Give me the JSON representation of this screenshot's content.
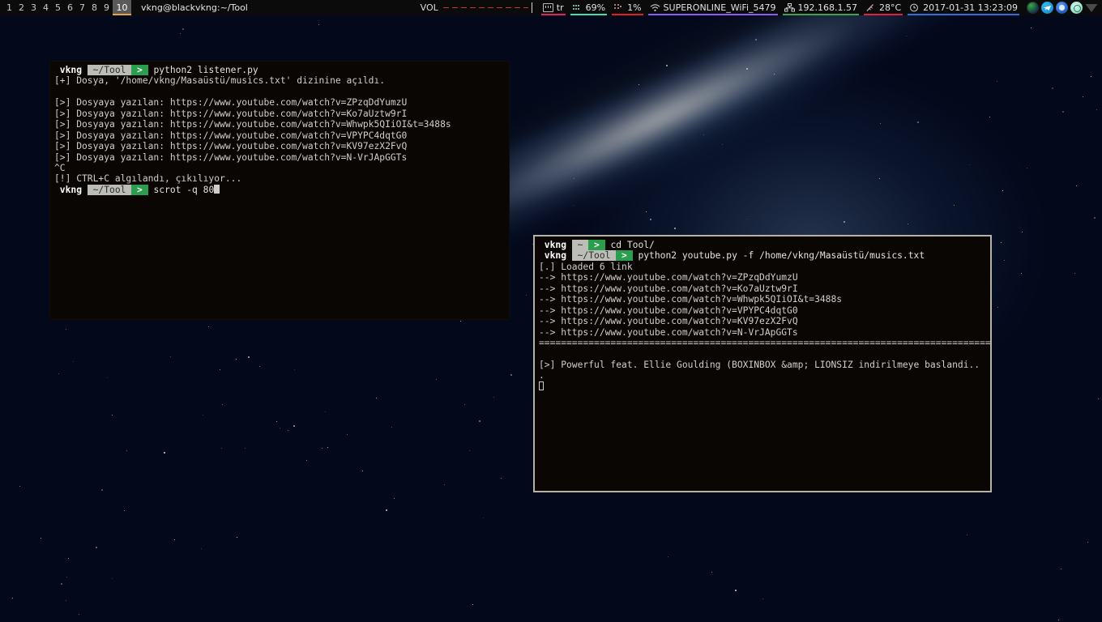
{
  "taskbar": {
    "workspaces": [
      "1",
      "2",
      "3",
      "4",
      "5",
      "6",
      "7",
      "8",
      "9",
      "10"
    ],
    "active_workspace": "10",
    "window_title": "vkng@blackvkng:~/Tool",
    "volume": {
      "label": "VOL"
    },
    "indicators": [
      {
        "name": "keyboard-layout",
        "icon": "keyboard-icon",
        "value": "tr",
        "color": "#e0245e"
      },
      {
        "name": "memory-usage",
        "icon": "memory-icon",
        "value": "69%",
        "color": "#3fe0b0"
      },
      {
        "name": "cpu-usage",
        "icon": "cpu-icon",
        "value": "1%",
        "color": "#e02020"
      },
      {
        "name": "wifi-network",
        "icon": "wifi-icon",
        "value": "SUPERONLINE_WiFi_5479",
        "color": "#8b5cf6"
      },
      {
        "name": "ip-address",
        "icon": "network-icon",
        "value": "192.168.1.57",
        "color": "#3fa34d"
      },
      {
        "name": "temperature",
        "icon": "thermometer-icon",
        "value": "28°C",
        "color": "#e02040"
      },
      {
        "name": "clock",
        "icon": "clock-icon",
        "value": "2017-01-31 13:23:09",
        "color": "#2f6fe0"
      }
    ],
    "tray": [
      "earth-icon",
      "telegram-icon",
      "browser-icon",
      "settings-icon",
      "wifi-fan-icon"
    ]
  },
  "terminal1": {
    "title": "vkng@blackvkng:~/Tool",
    "prompt": {
      "user": "vkng",
      "path": "~/Tool",
      "arrow": ">"
    },
    "lines": [
      {
        "type": "prompt",
        "command": "python2 listener.py"
      },
      {
        "type": "out",
        "text": "[+] Dosya, '/home/vkng/Masaüstü/musics.txt' dizinine açıldı."
      },
      {
        "type": "out",
        "text": ""
      },
      {
        "type": "out",
        "text": "[>] Dosyaya yazılan: https://www.youtube.com/watch?v=ZPzqDdYumzU"
      },
      {
        "type": "out",
        "text": "[>] Dosyaya yazılan: https://www.youtube.com/watch?v=Ko7aUztw9rI"
      },
      {
        "type": "out",
        "text": "[>] Dosyaya yazılan: https://www.youtube.com/watch?v=Whwpk5QIiOI&t=3488s"
      },
      {
        "type": "out",
        "text": "[>] Dosyaya yazılan: https://www.youtube.com/watch?v=VPYPC4dqtG0"
      },
      {
        "type": "out",
        "text": "[>] Dosyaya yazılan: https://www.youtube.com/watch?v=KV97ezX2FvQ"
      },
      {
        "type": "out",
        "text": "[>] Dosyaya yazılan: https://www.youtube.com/watch?v=N-VrJApGGTs"
      },
      {
        "type": "out",
        "text": "^C"
      },
      {
        "type": "out",
        "text": "[!] CTRL+C algılandı, çıkılıyor..."
      },
      {
        "type": "prompt-cursor",
        "command": "scrot -q 80"
      }
    ]
  },
  "terminal2": {
    "prompt_home": {
      "user": "vkng",
      "path": "~",
      "arrow": ">"
    },
    "prompt_tool": {
      "user": "vkng",
      "path": "~/Tool",
      "arrow": ">"
    },
    "lines": [
      {
        "type": "prompt-home",
        "command": "cd Tool/"
      },
      {
        "type": "prompt-tool",
        "command": "python2 youtube.py -f /home/vkng/Masaüstü/musics.txt"
      },
      {
        "type": "out",
        "text": "[.] Loaded 6 link"
      },
      {
        "type": "out",
        "text": "--> https://www.youtube.com/watch?v=ZPzqDdYumzU"
      },
      {
        "type": "out",
        "text": "--> https://www.youtube.com/watch?v=Ko7aUztw9rI"
      },
      {
        "type": "out",
        "text": "--> https://www.youtube.com/watch?v=Whwpk5QIiOI&t=3488s"
      },
      {
        "type": "out",
        "text": "--> https://www.youtube.com/watch?v=VPYPC4dqtG0"
      },
      {
        "type": "out",
        "text": "--> https://www.youtube.com/watch?v=KV97ezX2FvQ"
      },
      {
        "type": "out",
        "text": "--> https://www.youtube.com/watch?v=N-VrJApGGTs"
      },
      {
        "type": "out",
        "text": "=========================================================================="
      },
      {
        "type": "out",
        "text": ""
      },
      {
        "type": "out",
        "text": "[>] Powerful feat. Ellie Goulding (BOXINBOX &amp; LIONSIZ indirilmeye baslandi.."
      },
      {
        "type": "out",
        "text": "."
      },
      {
        "type": "cursor",
        "text": ""
      }
    ]
  }
}
